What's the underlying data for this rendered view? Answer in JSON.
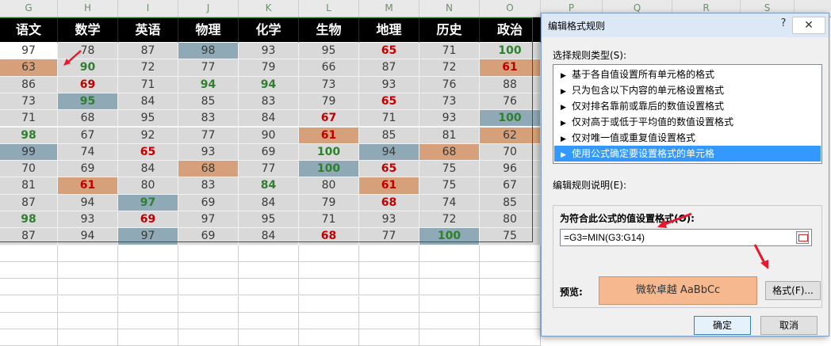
{
  "column_headers": [
    "G",
    "H",
    "I",
    "J",
    "K",
    "L",
    "M",
    "N",
    "O",
    "P",
    "Q",
    "R",
    "S"
  ],
  "table": {
    "headers": [
      "语文",
      "数学",
      "英语",
      "物理",
      "化学",
      "生物",
      "地理",
      "历史",
      "政治"
    ],
    "rows": [
      [
        {
          "v": "97",
          "bg": "white"
        },
        {
          "v": "78"
        },
        {
          "v": "87"
        },
        {
          "v": "98",
          "bg": "blue"
        },
        {
          "v": "93"
        },
        {
          "v": "95"
        },
        {
          "v": "65",
          "c": "red"
        },
        {
          "v": "71"
        },
        {
          "v": "100",
          "c": "green"
        }
      ],
      [
        {
          "v": "63",
          "bg": "tan"
        },
        {
          "v": "90",
          "c": "green"
        },
        {
          "v": "72"
        },
        {
          "v": "77"
        },
        {
          "v": "79"
        },
        {
          "v": "66"
        },
        {
          "v": "87"
        },
        {
          "v": "72"
        },
        {
          "v": "61",
          "c": "red",
          "bg": "tan"
        }
      ],
      [
        {
          "v": "86"
        },
        {
          "v": "69",
          "c": "red"
        },
        {
          "v": "71"
        },
        {
          "v": "94",
          "c": "green"
        },
        {
          "v": "94",
          "c": "green"
        },
        {
          "v": "73"
        },
        {
          "v": "93"
        },
        {
          "v": "76"
        },
        {
          "v": "88"
        }
      ],
      [
        {
          "v": "73"
        },
        {
          "v": "95",
          "c": "green",
          "bg": "blue"
        },
        {
          "v": "84"
        },
        {
          "v": "85"
        },
        {
          "v": "83"
        },
        {
          "v": "79"
        },
        {
          "v": "65",
          "c": "red"
        },
        {
          "v": "73"
        },
        {
          "v": "76"
        }
      ],
      [
        {
          "v": "71"
        },
        {
          "v": "68"
        },
        {
          "v": "95"
        },
        {
          "v": "83"
        },
        {
          "v": "84"
        },
        {
          "v": "67",
          "c": "red"
        },
        {
          "v": "71"
        },
        {
          "v": "93"
        },
        {
          "v": "100",
          "c": "green",
          "bg": "blue"
        }
      ],
      [
        {
          "v": "98",
          "c": "green"
        },
        {
          "v": "67"
        },
        {
          "v": "92"
        },
        {
          "v": "77"
        },
        {
          "v": "90"
        },
        {
          "v": "61",
          "c": "red",
          "bg": "tan"
        },
        {
          "v": "85"
        },
        {
          "v": "81"
        },
        {
          "v": "62",
          "bg": "tan"
        }
      ],
      [
        {
          "v": "99",
          "bg": "blue"
        },
        {
          "v": "74"
        },
        {
          "v": "65",
          "c": "red"
        },
        {
          "v": "93"
        },
        {
          "v": "69"
        },
        {
          "v": "100",
          "c": "green"
        },
        {
          "v": "94",
          "bg": "blue"
        },
        {
          "v": "68",
          "bg": "tan"
        },
        {
          "v": "70"
        }
      ],
      [
        {
          "v": "70"
        },
        {
          "v": "69"
        },
        {
          "v": "84"
        },
        {
          "v": "68",
          "bg": "tan"
        },
        {
          "v": "77"
        },
        {
          "v": "100",
          "c": "green",
          "bg": "blue"
        },
        {
          "v": "65",
          "c": "red"
        },
        {
          "v": "75"
        },
        {
          "v": "96"
        }
      ],
      [
        {
          "v": "81"
        },
        {
          "v": "61",
          "c": "red",
          "bg": "tan"
        },
        {
          "v": "80"
        },
        {
          "v": "83"
        },
        {
          "v": "84",
          "c": "green"
        },
        {
          "v": "80"
        },
        {
          "v": "61",
          "c": "red",
          "bg": "tan"
        },
        {
          "v": "75"
        },
        {
          "v": "67"
        }
      ],
      [
        {
          "v": "87"
        },
        {
          "v": "94"
        },
        {
          "v": "97",
          "c": "green",
          "bg": "blue"
        },
        {
          "v": "69"
        },
        {
          "v": "84"
        },
        {
          "v": "79"
        },
        {
          "v": "68",
          "c": "red"
        },
        {
          "v": "74"
        },
        {
          "v": "85"
        }
      ],
      [
        {
          "v": "98",
          "c": "green"
        },
        {
          "v": "93"
        },
        {
          "v": "69",
          "c": "red"
        },
        {
          "v": "97"
        },
        {
          "v": "95"
        },
        {
          "v": "71"
        },
        {
          "v": "93"
        },
        {
          "v": "72"
        },
        {
          "v": "80"
        }
      ],
      [
        {
          "v": "87"
        },
        {
          "v": "94"
        },
        {
          "v": "97",
          "bg": "blue"
        },
        {
          "v": "69"
        },
        {
          "v": "84"
        },
        {
          "v": "68",
          "c": "red"
        },
        {
          "v": "77"
        },
        {
          "v": "100",
          "c": "green",
          "bg": "blue"
        },
        {
          "v": "75"
        }
      ]
    ]
  },
  "dialog": {
    "title": "编辑格式规则",
    "help": "?",
    "close": "✕",
    "select_rule_type_label": "选择规则类型(S):",
    "rule_types": [
      "基于各自值设置所有单元格的格式",
      "只为包含以下内容的单元格设置格式",
      "仅对排名靠前或靠后的数值设置格式",
      "仅对高于或低于平均值的数值设置格式",
      "仅对唯一值或重复值设置格式",
      "使用公式确定要设置格式的单元格"
    ],
    "selected_rule_index": 5,
    "edit_desc_label": "编辑规则说明(E):",
    "formula_label": "为符合此公式的值设置格式(O):",
    "formula_value": "=G3=MIN(G3:G14)",
    "preview_label": "预览:",
    "preview_text": "微软卓越  AaBbCc",
    "format_button": "格式(F)...",
    "ok_button": "确定",
    "cancel_button": "取消"
  },
  "colors": {
    "tan": "#d6a17a",
    "blue": "#8fa9b6",
    "red_text": "#c00000",
    "green_text": "#2f7f2f",
    "preview_fill": "#f5b88f",
    "selection": "#3399ff",
    "annotation_arrow": "#e8192c"
  }
}
